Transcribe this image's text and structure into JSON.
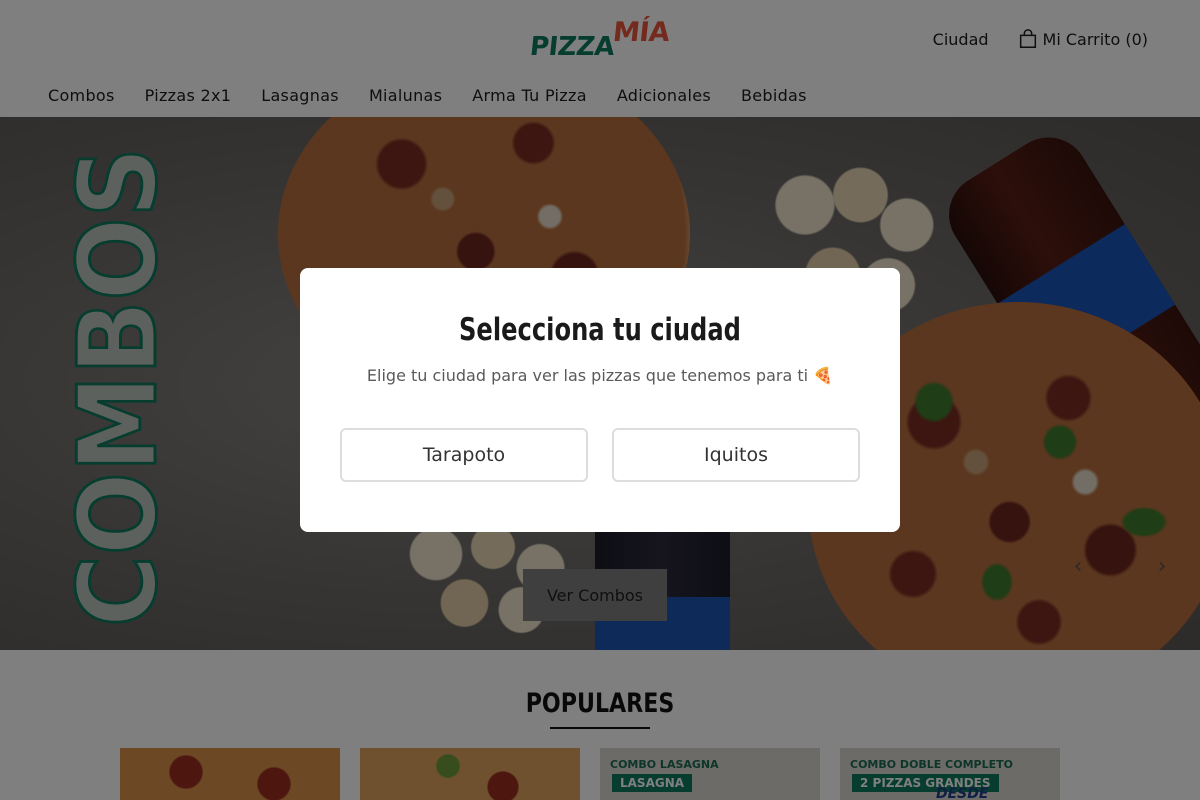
{
  "brand": {
    "logo_pizza": "PIZZA",
    "logo_mia": "MÍA"
  },
  "header": {
    "city_link": "Ciudad",
    "cart_label": "Mi Carrito (0)"
  },
  "menu": {
    "items": [
      {
        "label": "Combos"
      },
      {
        "label": "Pizzas 2x1"
      },
      {
        "label": "Lasagnas"
      },
      {
        "label": "Mialunas"
      },
      {
        "label": "Arma Tu Pizza"
      },
      {
        "label": "Adicionales"
      },
      {
        "label": "Bebidas"
      }
    ]
  },
  "hero": {
    "word": "COMBOS",
    "cta_label": "Ver Combos",
    "prev_arrow": "‹",
    "next_arrow": "›"
  },
  "populares": {
    "title": "POPULARES",
    "cards": [
      {
        "text": ""
      },
      {
        "text": ""
      },
      {
        "title": "COMBO LASAGNA",
        "tag": "LASAGNA"
      },
      {
        "title": "COMBO DOBLE COMPLETO",
        "tag": "2 PIZZAS GRANDES",
        "sub": "DESDE"
      }
    ]
  },
  "modal": {
    "title": "Selecciona tu ciudad",
    "subtitle": "Elige tu ciudad para ver las pizzas que tenemos para ti 🍕",
    "cities": [
      {
        "label": "Tarapoto"
      },
      {
        "label": "Iquitos"
      }
    ]
  },
  "colors": {
    "brand_green": "#0f7a5e",
    "brand_red": "#e8553a",
    "overlay": "rgba(0,0,0,0.5)"
  },
  "icons": {
    "cart": "shopping-bag-icon"
  }
}
